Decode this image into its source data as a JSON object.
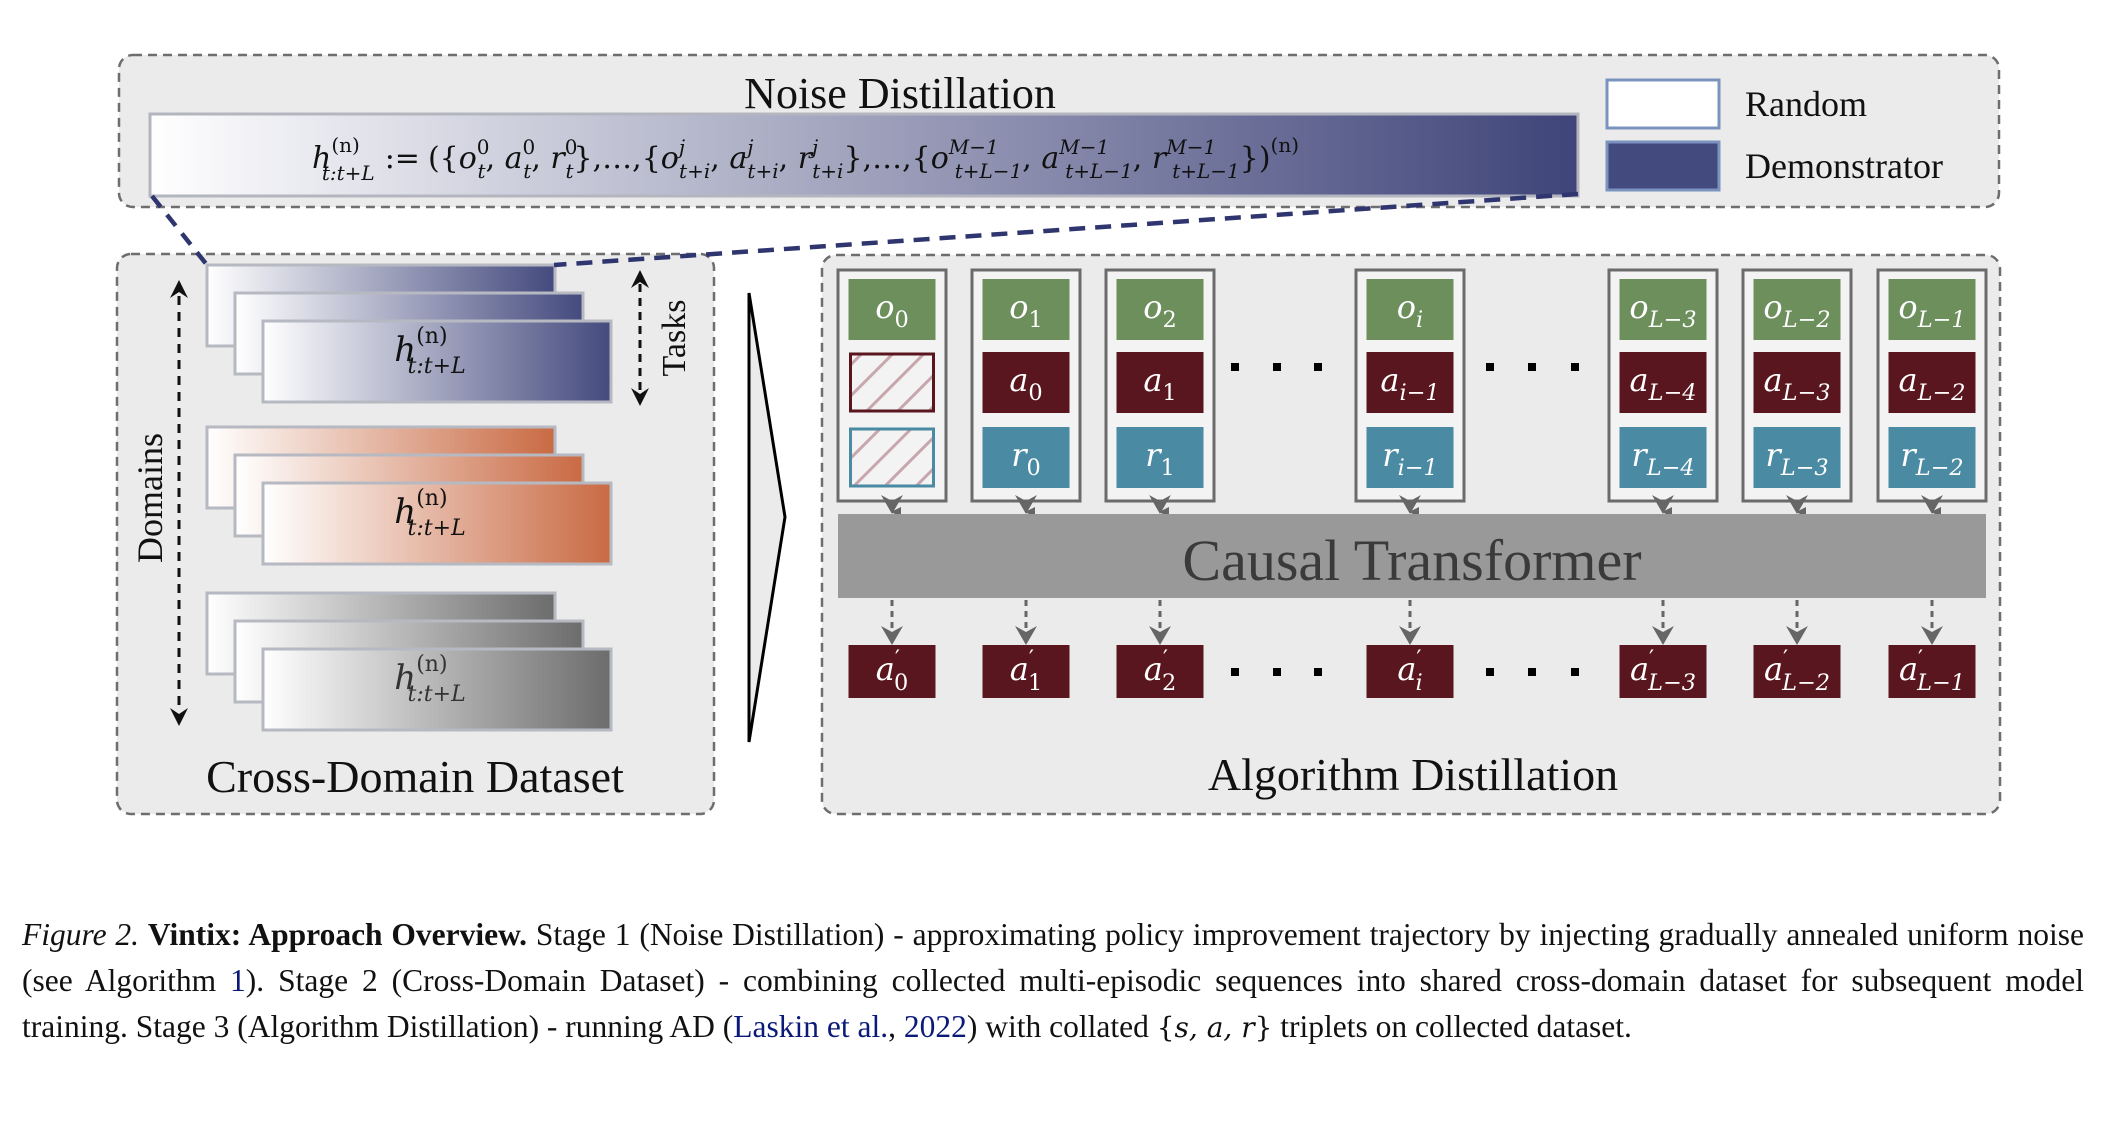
{
  "figure": {
    "stage1": {
      "title": "Noise Distillation",
      "formula": {
        "lhs_base": "h",
        "lhs_sup": "(n)",
        "lhs_sub": "t:t+L",
        "assign": ":=",
        "open": "({",
        "t1": {
          "o": "o",
          "a": "a",
          "r": "r",
          "sup": "0",
          "sub": "t"
        },
        "sep1": "},…,{",
        "t2": {
          "o": "o",
          "a": "a",
          "r": "r",
          "sup": "j",
          "sub": "t+i"
        },
        "sep2": "},…,{",
        "t3": {
          "o": "o",
          "a": "a",
          "r": "r",
          "sup": "M−1",
          "sub": "t+L−1"
        },
        "close": "})",
        "close_sup": "(n)"
      },
      "legend": [
        {
          "label": "Random",
          "color": "#ffffff"
        },
        {
          "label": "Demonstrator",
          "color": "#434a7d"
        }
      ]
    },
    "stage2": {
      "title": "Cross-Domain Dataset",
      "domains_label": "Domains",
      "tasks_label": "Tasks",
      "card_label": {
        "base": "h",
        "sup": "(n)",
        "sub": "t:t+L"
      },
      "domain_groups": [
        {
          "name": "domain-1",
          "end_color": "#444a7e"
        },
        {
          "name": "domain-2",
          "end_color": "#c96a43"
        },
        {
          "name": "domain-3",
          "end_color": "#6c6c6c"
        }
      ]
    },
    "stage3": {
      "title": "Algorithm Distillation",
      "model_label": "Causal Transformer",
      "columns": [
        {
          "o": {
            "b": "o",
            "s": "0"
          },
          "a": null,
          "r": null,
          "out": {
            "b": "a",
            "s": "0"
          }
        },
        {
          "o": {
            "b": "o",
            "s": "1"
          },
          "a": {
            "b": "a",
            "s": "0"
          },
          "r": {
            "b": "r",
            "s": "0"
          },
          "out": {
            "b": "a",
            "s": "1"
          }
        },
        {
          "o": {
            "b": "o",
            "s": "2"
          },
          "a": {
            "b": "a",
            "s": "1"
          },
          "r": {
            "b": "r",
            "s": "1"
          },
          "out": {
            "b": "a",
            "s": "2"
          }
        },
        {
          "o": {
            "b": "o",
            "s": "i"
          },
          "a": {
            "b": "a",
            "s": "i−1"
          },
          "r": {
            "b": "r",
            "s": "i−1"
          },
          "out": {
            "b": "a",
            "s": "i"
          }
        },
        {
          "o": {
            "b": "o",
            "s": "L−3"
          },
          "a": {
            "b": "a",
            "s": "L−4"
          },
          "r": {
            "b": "r",
            "s": "L−4"
          },
          "out": {
            "b": "a",
            "s": "L−3"
          }
        },
        {
          "o": {
            "b": "o",
            "s": "L−2"
          },
          "a": {
            "b": "a",
            "s": "L−3"
          },
          "r": {
            "b": "r",
            "s": "L−3"
          },
          "out": {
            "b": "a",
            "s": "L−2"
          }
        },
        {
          "o": {
            "b": "o",
            "s": "L−1"
          },
          "a": {
            "b": "a",
            "s": "L−2"
          },
          "r": {
            "b": "r",
            "s": "L−2"
          },
          "out": {
            "b": "a",
            "s": "L−1"
          }
        }
      ],
      "prime": "′",
      "colors": {
        "obs": "#6c8f5c",
        "act": "#5a161e",
        "rew": "#4a8aa3",
        "model": "#999999"
      }
    }
  },
  "caption": {
    "figure_label": "Figure 2.",
    "title": "Vintix: Approach Overview.",
    "part1": " Stage 1 (Noise Distillation) - approximating policy improvement trajectory by injecting gradually annealed uniform noise (see Algorithm ",
    "algo_ref": "1",
    "part2": "). Stage 2 (Cross-Domain Dataset) - combining collected multi-episodic sequences into shared cross-domain dataset for subsequent model training. Stage 3 (Algorithm Distillation) - running AD (",
    "cite_authors": "Laskin et al.",
    "cite_sep": ", ",
    "cite_year": "2022",
    "part3": ") with collated ",
    "math_open": "{",
    "math_body": "s, a, r",
    "math_close": "}",
    "part4": " triplets on collected dataset."
  }
}
